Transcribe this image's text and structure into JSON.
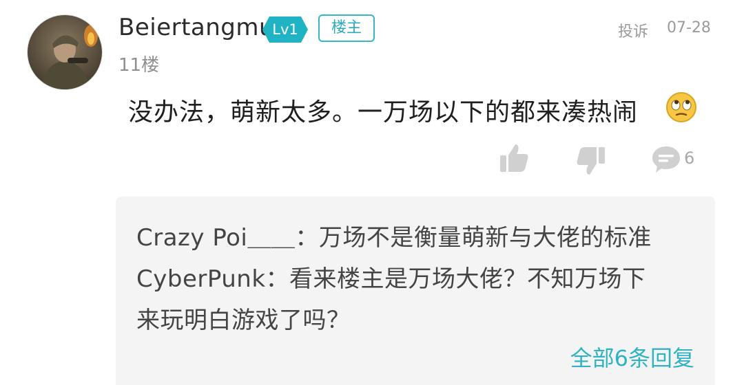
{
  "post": {
    "username": "Beiertangmu.",
    "level_badge": "Lv1",
    "op_badge": "楼主",
    "report_label": "投诉",
    "date": "07-28",
    "floor": "11楼",
    "content": "没办法，萌新太多。一万场以下的都来凑热闹",
    "emoji_name": "rolling-eyes-emoji",
    "comment_count": "6",
    "colors": {
      "accent": "#35b6c6",
      "reply_bg": "#f4f4f4",
      "muted_text": "#9a9a9a",
      "icon_gray": "#d0d0d0"
    }
  },
  "replies": {
    "lines": [
      "Crazy Poi＿＿：万场不是衡量萌新与大佬的标准",
      "CyberPunk：看来楼主是万场大佬？不知万场下",
      "来玩明白游戏了吗？"
    ],
    "view_all_label": "全部6条回复"
  }
}
